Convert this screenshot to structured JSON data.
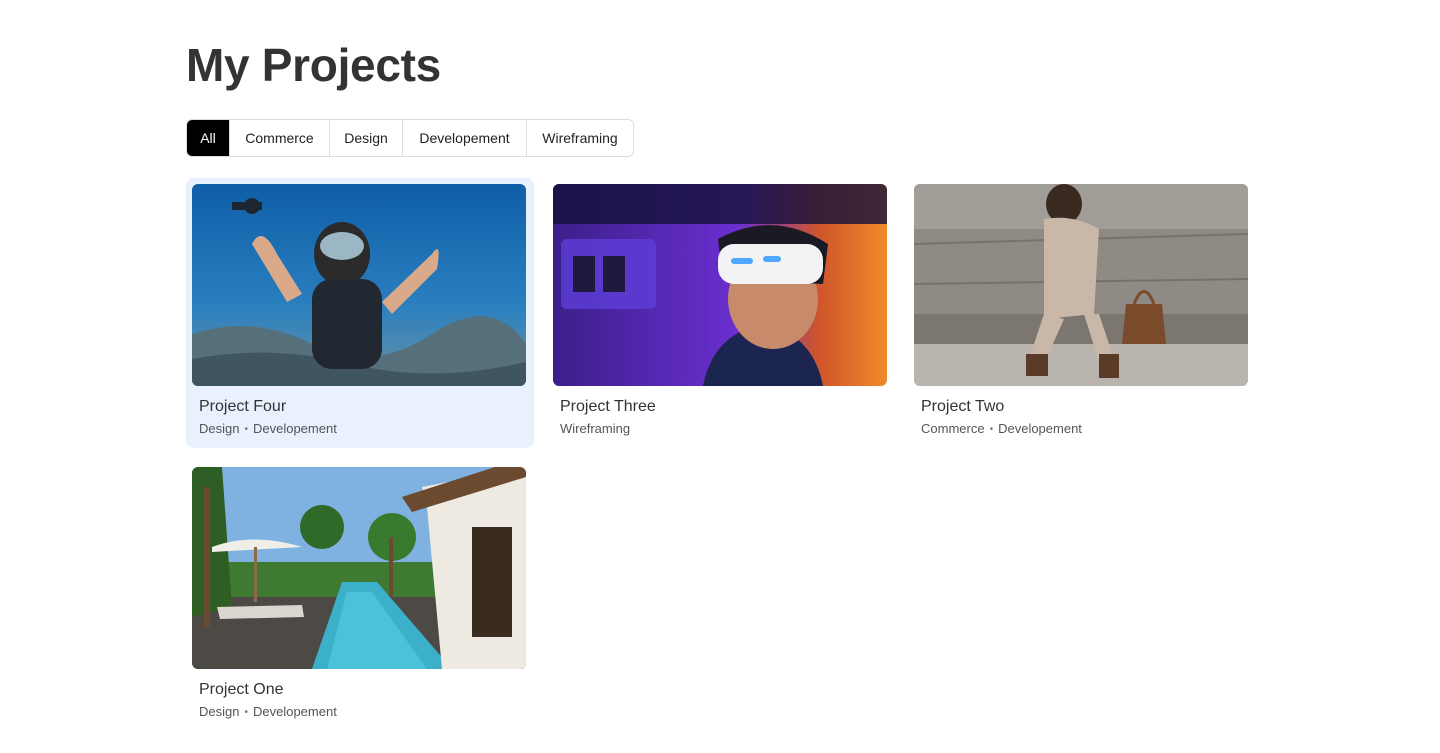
{
  "page": {
    "title": "My Projects"
  },
  "filters": [
    {
      "label": "All",
      "active": true
    },
    {
      "label": "Commerce",
      "active": false
    },
    {
      "label": "Design",
      "active": false
    },
    {
      "label": "Developement",
      "active": false
    },
    {
      "label": "Wireframing",
      "active": false
    }
  ],
  "projects": [
    {
      "name": "Project Four",
      "tags": [
        "Design",
        "Developement"
      ],
      "image": "scuba-diver-photo",
      "highlighted": true
    },
    {
      "name": "Project Three",
      "tags": [
        "Wireframing"
      ],
      "image": "vr-headset-photo",
      "highlighted": false
    },
    {
      "name": "Project Two",
      "tags": [
        "Commerce",
        "Developement"
      ],
      "image": "woman-sitting-with-handbag-photo",
      "highlighted": false
    },
    {
      "name": "Project One",
      "tags": [
        "Design",
        "Developement"
      ],
      "image": "resort-pool-photo",
      "highlighted": false
    }
  ],
  "colors": {
    "active_filter_bg": "#000000",
    "highlight_card_bg": "#e8f1fd",
    "text": "#333333"
  }
}
